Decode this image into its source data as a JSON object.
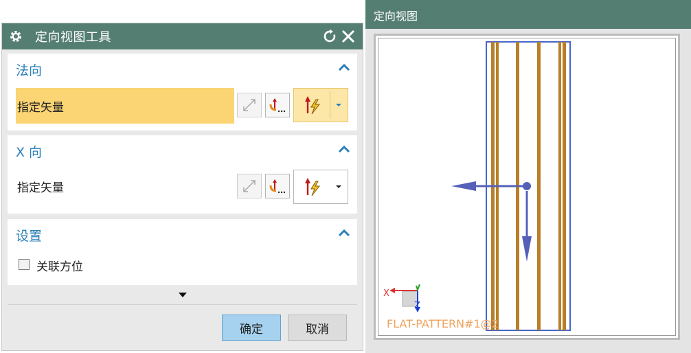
{
  "dialog": {
    "title": "定向视图工具",
    "sections": {
      "normal": {
        "header": "法向",
        "vector_label": "指定矢量"
      },
      "x_dir": {
        "header": "X 向",
        "vector_label": "指定矢量"
      },
      "settings": {
        "header": "设置",
        "checkbox_label": "关联方位",
        "checked": false
      }
    },
    "ok_label": "确定",
    "cancel_label": "取消"
  },
  "view": {
    "title": "定向视图",
    "triad_x": "X",
    "triad_z": "Z",
    "pattern_label": "FLAT-PATTERN#1@2"
  },
  "colors": {
    "titlebar": "#557e73",
    "section_header": "#2a7fb8",
    "highlight": "#fbd474",
    "ok_button": "#a6d2ef",
    "stripe": "#b87f28",
    "outline": "#4a64c8",
    "arrow": "#5560b8"
  }
}
